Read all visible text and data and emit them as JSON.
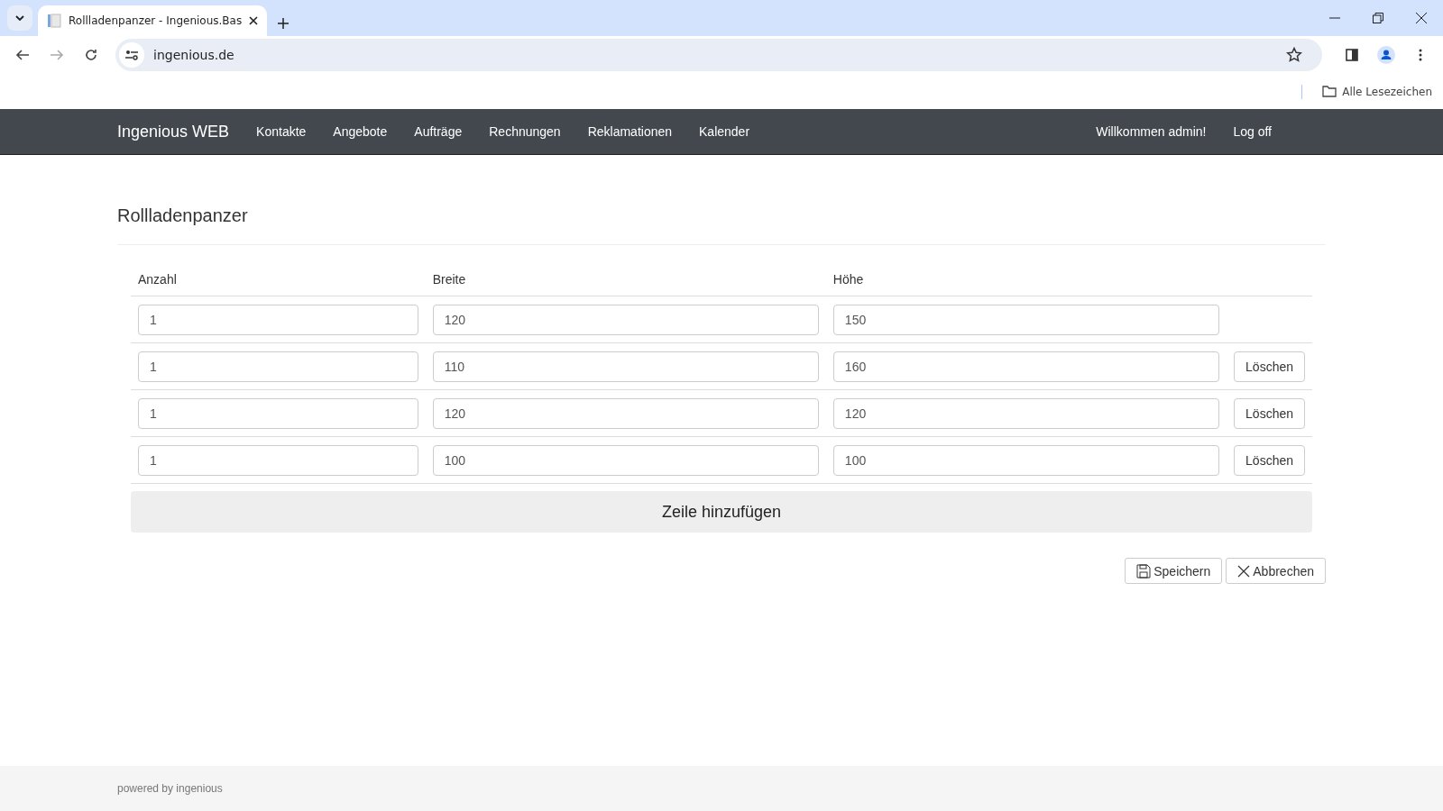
{
  "browser": {
    "tab_title": "Rollladenpanzer - Ingenious.Bas",
    "url": "ingenious.de",
    "bookmarks_label": "Alle Lesezeichen"
  },
  "navbar": {
    "brand": "Ingenious WEB",
    "links": [
      "Kontakte",
      "Angebote",
      "Aufträge",
      "Rechnungen",
      "Reklamationen",
      "Kalender"
    ],
    "welcome": "Willkommen admin!",
    "logoff": "Log off"
  },
  "page": {
    "title": "Rollladenpanzer"
  },
  "table": {
    "columns": [
      "Anzahl",
      "Breite",
      "Höhe"
    ],
    "rows": [
      {
        "values": [
          "1",
          "120",
          "150"
        ]
      },
      {
        "values": [
          "1",
          "110",
          "160"
        ],
        "delete_label": "Löschen"
      },
      {
        "values": [
          "1",
          "120",
          "120"
        ],
        "delete_label": "Löschen"
      },
      {
        "values": [
          "1",
          "100",
          "100"
        ],
        "delete_label": "Löschen"
      }
    ]
  },
  "add_row_button": "Zeile hinzufügen",
  "actions": {
    "save": "Speichern",
    "cancel": "Abbrechen"
  },
  "footer": "powered by ingenious"
}
